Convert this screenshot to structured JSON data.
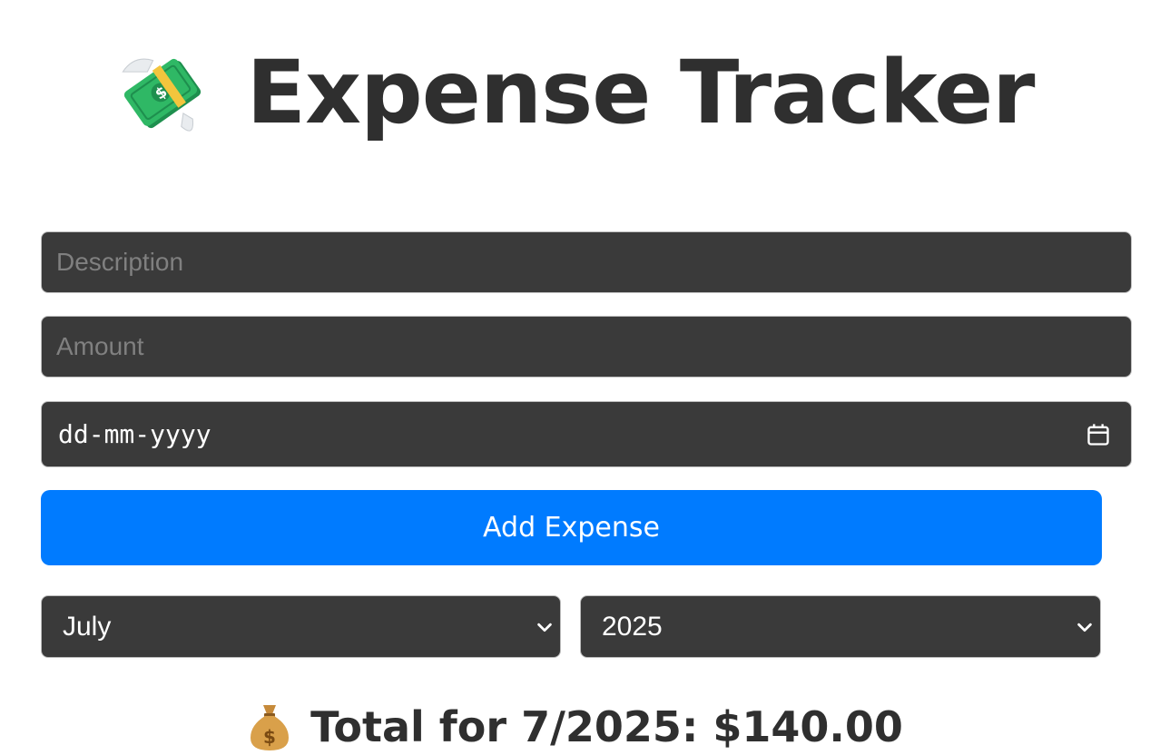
{
  "header": {
    "title": "Expense Tracker",
    "icon": "money-with-wings-icon"
  },
  "form": {
    "description_placeholder": "Description",
    "amount_placeholder": "Amount",
    "date_placeholder": "dd-mm-yyyy",
    "date_icon": "calendar-icon",
    "add_button_label": "Add Expense"
  },
  "filters": {
    "month": "July",
    "year": "2025",
    "chevron_icon": "chevron-down-icon"
  },
  "summary": {
    "icon": "money-bag-icon",
    "total_text": "Total for 7/2025: $140.00"
  },
  "colors": {
    "accent": "#007bff",
    "field_bg": "#3a3a3a",
    "text_dark": "#2f2f2f"
  }
}
